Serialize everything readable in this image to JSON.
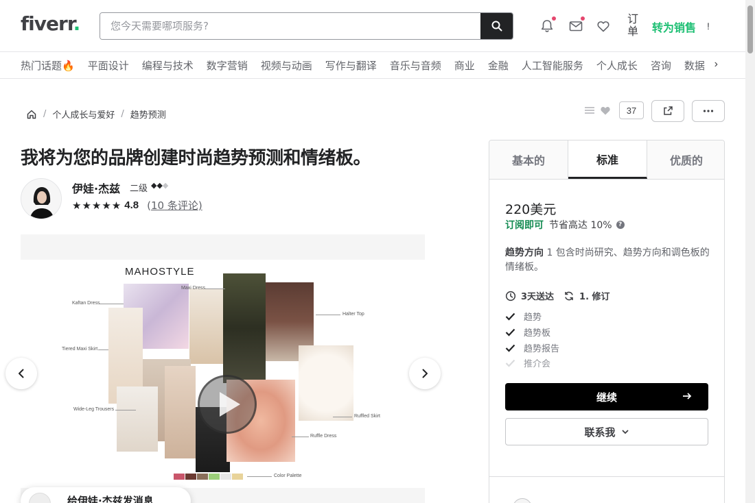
{
  "header": {
    "logo": "fiverr",
    "logo_dot": ".",
    "search_placeholder": "您今天需要哪项服务?",
    "orders_label": "订单",
    "switch_selling": "转为销售",
    "cut_text": "!"
  },
  "categories": [
    "热门话题🔥",
    "平面设计",
    "编程与技术",
    "数字营销",
    "视频与动画",
    "写作与翻译",
    "音乐与音频",
    "商业",
    "金融",
    "人工智能服务",
    "个人成长",
    "咨询",
    "数据"
  ],
  "breadcrumb": {
    "items": [
      "个人成长与爱好",
      "趋势预测"
    ]
  },
  "actions": {
    "favorites_count": "37"
  },
  "gig": {
    "title": "我将为您的品牌创建时尚趋势预测和情绪板。",
    "seller_name": "伊娃·杰兹",
    "seller_level": "二级",
    "rating": "4.8",
    "reviews_count": "10",
    "reviews_open": "(",
    "reviews_suffix": " 条评论)",
    "stars": "★★★★★"
  },
  "gallery": {
    "moodboard_title": "MAHOSTYLE",
    "labels": [
      "Maxi Dress",
      "Kaftan Dress",
      "Halter Top",
      "Tiered Maxi Skirt",
      "Wide-Leg Trousers",
      "Ruffled Skirt",
      "Ruffle Dress",
      "Color Palette"
    ],
    "swatches": [
      "#c9566b",
      "#6b3a32",
      "#8a6f5a",
      "#9ccf7a",
      "#e6e6e6",
      "#e8d39a"
    ]
  },
  "message_pill": {
    "text": "给伊娃·杰兹发消息"
  },
  "package": {
    "tabs": [
      "基本的",
      "标准",
      "优质的"
    ],
    "active_tab": 1,
    "price": "220美元",
    "subscribe_label": "订阅即可",
    "subscribe_save": "节省高达 10%",
    "subscribe_help": "?",
    "desc_title": "趋势方向",
    "desc_text": " 1 包含时尚研究、趋势方向和调色板的情绪板。",
    "delivery": "3天送达",
    "revisions": "1. 修订",
    "features": [
      {
        "label": "趋势",
        "included": true
      },
      {
        "label": "趋势板",
        "included": true
      },
      {
        "label": "趋势报告",
        "included": true
      },
      {
        "label": "推介会",
        "included": false
      }
    ],
    "continue_label": "继续",
    "contact_label": "联系我"
  },
  "colors": {
    "brand_green": "#1dbf73",
    "dark": "#222325",
    "notification_badge": "#e5476e"
  }
}
